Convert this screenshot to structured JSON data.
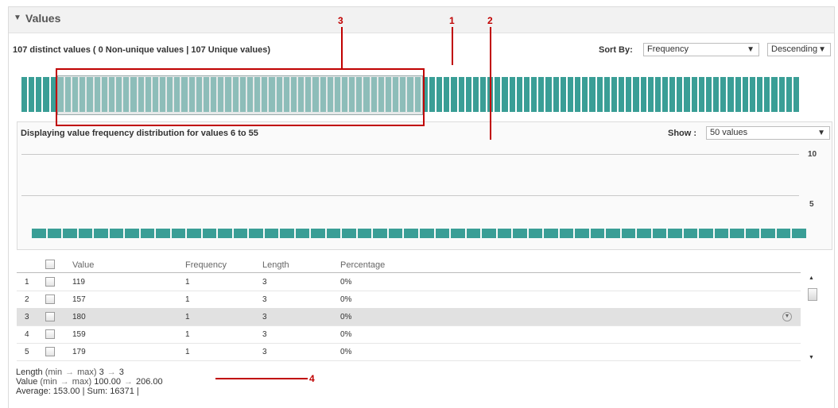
{
  "section": {
    "title": "Values",
    "collapse_icon": "triangle-down-icon"
  },
  "summary": "107 distinct values ( 0 Non-unique values | 107 Unique values)",
  "sort": {
    "label": "Sort By:",
    "field": "Frequency",
    "order": "Descending"
  },
  "overview": {
    "total_values": 107,
    "selection_start": 6,
    "selection_end": 55
  },
  "detail": {
    "title": "Displaying value frequency distribution for values 6 to 55",
    "show_label": "Show :",
    "show_value": "50 values",
    "y_ticks": [
      "10",
      "5"
    ]
  },
  "callouts": [
    "1",
    "2",
    "3",
    "4"
  ],
  "table": {
    "headers": {
      "value": "Value",
      "frequency": "Frequency",
      "length": "Length",
      "percentage": "Percentage"
    },
    "rows": [
      {
        "index": "1",
        "value": "119",
        "frequency": "1",
        "length": "3",
        "percentage": "0%",
        "selected": false
      },
      {
        "index": "2",
        "value": "157",
        "frequency": "1",
        "length": "3",
        "percentage": "0%",
        "selected": false
      },
      {
        "index": "3",
        "value": "180",
        "frequency": "1",
        "length": "3",
        "percentage": "0%",
        "selected": true
      },
      {
        "index": "4",
        "value": "159",
        "frequency": "1",
        "length": "3",
        "percentage": "0%",
        "selected": false
      },
      {
        "index": "5",
        "value": "179",
        "frequency": "1",
        "length": "3",
        "percentage": "0%",
        "selected": false
      }
    ]
  },
  "stats": {
    "length_label": "Length",
    "minmax": "(min",
    "max": "max)",
    "length_min": "3",
    "length_max": "3",
    "value_label": "Value",
    "value_min": "100.00",
    "value_max": "206.00",
    "average_sum": "Average: 153.00 | Sum: 16371 |"
  },
  "colors": {
    "bar": "#3a9e96",
    "callout": "#c00000",
    "selected_row": "#e1e1e1"
  }
}
